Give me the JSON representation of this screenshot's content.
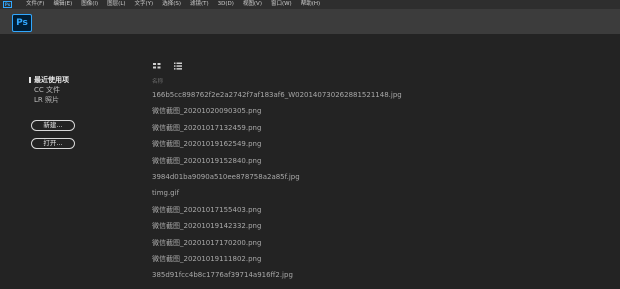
{
  "menubar": {
    "app_icon": "Ps",
    "items": [
      "文件(F)",
      "编辑(E)",
      "图像(I)",
      "图层(L)",
      "文字(Y)",
      "选择(S)",
      "滤镜(T)",
      "3D(D)",
      "视图(V)",
      "窗口(W)",
      "帮助(H)"
    ]
  },
  "toolbar": {
    "logo": "Ps"
  },
  "view_toggles": {
    "grid_icon": "grid-view-icon",
    "list_icon": "list-view-icon"
  },
  "sidebar": {
    "items": [
      "最近使用项",
      "CC 文件",
      "LR 照片"
    ],
    "new_button": "新建...",
    "open_button": "打开..."
  },
  "file_list": {
    "column_header": "名称",
    "files": [
      "166b5cc898762f2e2a2742f7af183af6_W020140730262881521148.jpg",
      "微信截图_20201020090305.png",
      "微信截图_20201017132459.png",
      "微信截图_20201019162549.png",
      "微信截图_20201019152840.png",
      "3984d01ba9090a510ee878758a2a85f.jpg",
      "timg.gif",
      "微信截图_20201017155403.png",
      "微信截图_20201019142332.png",
      "微信截图_20201017170200.png",
      "微信截图_20201019111802.png",
      "385d91fcc4b8c1776af39714a916ff2.jpg"
    ]
  },
  "colors": {
    "accent": "#31a8ff",
    "background": "#232323",
    "toolbar": "#3c3c3c",
    "menubar": "#2e2e2e"
  }
}
